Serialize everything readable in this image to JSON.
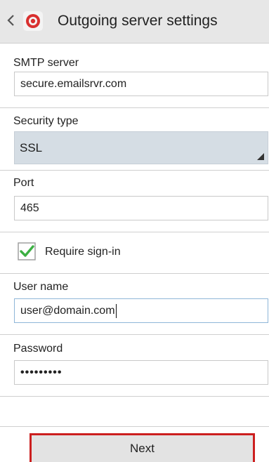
{
  "header": {
    "title": "Outgoing server settings",
    "back_icon": "chevron-left-icon",
    "app_icon": "email-app-icon",
    "app_icon_color": "#d9302f"
  },
  "smtp": {
    "label": "SMTP server",
    "value": "secure.emailsrvr.com"
  },
  "security": {
    "label": "Security type",
    "value": "SSL"
  },
  "port": {
    "label": "Port",
    "value": "465"
  },
  "require_signin": {
    "label": "Require sign-in",
    "checked": true,
    "check_color": "#3cb043"
  },
  "username": {
    "label": "User name",
    "value": "user@domain.com"
  },
  "password": {
    "label": "Password",
    "value": "•••••••••"
  },
  "next_button": {
    "label": "Next",
    "highlight_color": "#cc1f1f"
  }
}
